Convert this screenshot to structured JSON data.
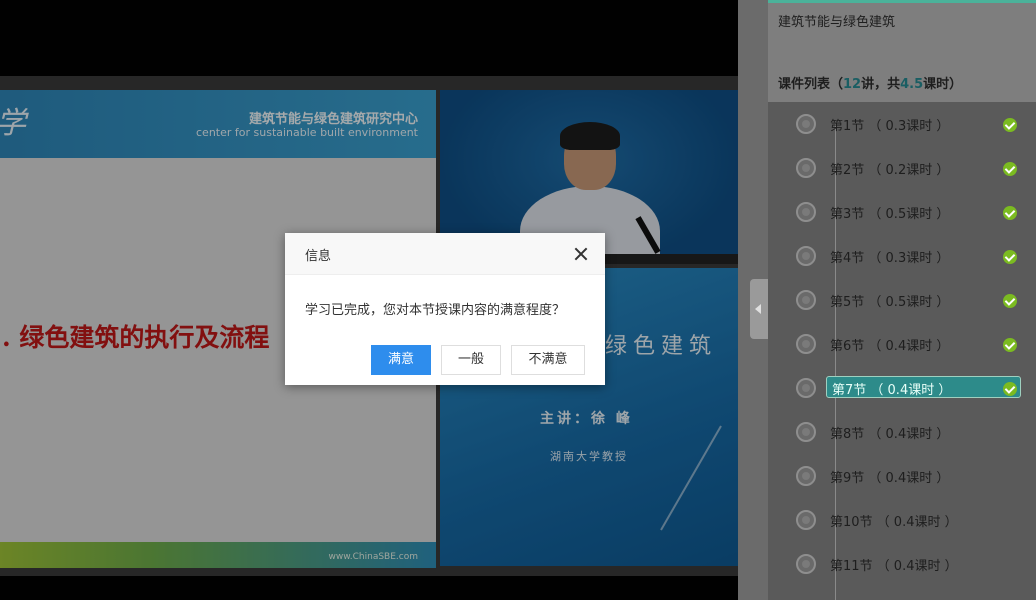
{
  "video": {
    "slide": {
      "logo_char": "学",
      "org_cn": "建筑节能与绿色建筑研究中心",
      "org_en": "center for sustainable built environment",
      "title": ". 绿色建筑的执行及流程",
      "url": "www.ChinaSBE.com"
    },
    "poster": {
      "title": "绿色建筑",
      "speaker": "主讲：徐 峰",
      "org": "湖南大学教授"
    }
  },
  "dialog": {
    "title": "信息",
    "message": "学习已完成，您对本节授课内容的满意程度？",
    "buttons": {
      "satisfied": "满意",
      "normal": "一般",
      "unsatisfied": "不满意"
    }
  },
  "sidebar": {
    "course_title": "建筑节能与绿色建筑",
    "list_label_prefix": "课件列表（",
    "lecture_count": "12",
    "list_label_middle": "讲，共",
    "total_hours": "4.5",
    "list_label_suffix": "课时）",
    "lessons": [
      {
        "label": "第1节 （ 0.3课时 ）",
        "done": true
      },
      {
        "label": "第2节 （ 0.2课时 ）",
        "done": true
      },
      {
        "label": "第3节 （ 0.5课时 ）",
        "done": true
      },
      {
        "label": "第4节 （ 0.3课时 ）",
        "done": true
      },
      {
        "label": "第5节 （ 0.5课时 ）",
        "done": true
      },
      {
        "label": "第6节 （ 0.4课时 ）",
        "done": true
      },
      {
        "label": "第7节 （ 0.4课时 ）",
        "done": true,
        "active": true
      },
      {
        "label": "第8节 （ 0.4课时 ）",
        "done": false
      },
      {
        "label": "第9节 （ 0.4课时 ）",
        "done": false
      },
      {
        "label": "第10节 （ 0.4课时 ）",
        "done": false
      },
      {
        "label": "第11节 （ 0.4课时 ）",
        "done": false
      }
    ]
  },
  "colors": {
    "primary_button": "#2e8ded",
    "check": "#7bbb21",
    "active_lesson": "#2d8b8a",
    "slide_title": "#c01818"
  }
}
